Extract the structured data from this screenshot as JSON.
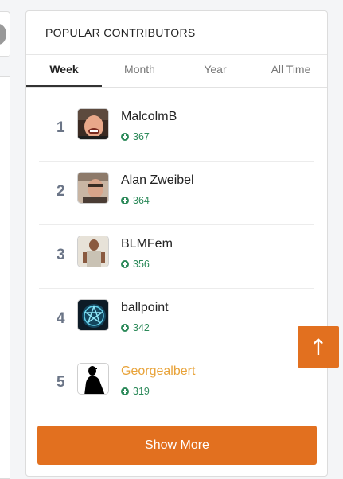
{
  "widget": {
    "title": "POPULAR CONTRIBUTORS",
    "tabs": [
      {
        "label": "Week",
        "active": true
      },
      {
        "label": "Month",
        "active": false
      },
      {
        "label": "Year",
        "active": false
      },
      {
        "label": "All Time",
        "active": false
      }
    ],
    "contributors": [
      {
        "rank": "1",
        "name": "MalcolmB",
        "points": "367",
        "avatar": "photo-avatar"
      },
      {
        "rank": "2",
        "name": "Alan Zweibel",
        "points": "364",
        "avatar": "photo-avatar"
      },
      {
        "rank": "3",
        "name": "BLMFem",
        "points": "356",
        "avatar": "photo-avatar"
      },
      {
        "rank": "4",
        "name": "ballpoint",
        "points": "342",
        "avatar": "pentagram-logo-avatar"
      },
      {
        "rank": "5",
        "name": "Georgealbert",
        "points": "319",
        "avatar": "silhouette-avatar",
        "name_color": "#e8a33a"
      }
    ],
    "show_more_label": "Show More"
  },
  "scroll_top": {
    "icon": "up-arrow-icon",
    "glyph": "↑"
  },
  "colors": {
    "accent": "#e2701f",
    "points": "#2d8a5a",
    "rank": "#6b7587",
    "highlight_name": "#e8a33a"
  }
}
